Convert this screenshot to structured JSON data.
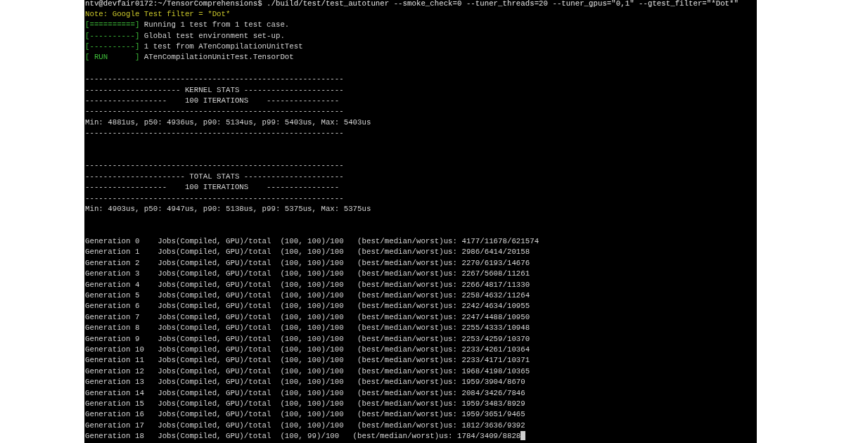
{
  "terminal": {
    "cursor": true,
    "lines": [
      {
        "kind": "prompt",
        "text": "ntv@devfair0172:~/TensorComprehensions$ ./build/test/test_autotuner --smoke_check=0 --tuner_threads=20 --tuner_gpus=\"0,1\" --gtest_filter=\"*Dot*\""
      },
      {
        "kind": "note",
        "text": "Note: Google Test filter = *Dot*"
      },
      {
        "kind": "gtest",
        "tag": "[==========]",
        "text": "Running 1 test from 1 test case."
      },
      {
        "kind": "gtest",
        "tag": "[----------]",
        "text": "Global test environment set-up."
      },
      {
        "kind": "gtest",
        "tag": "[----------]",
        "text": "1 test from ATenCompilationUnitTest"
      },
      {
        "kind": "gtest",
        "tag": "[ RUN      ]",
        "text": "ATenCompilationUnitTest.TensorDot"
      },
      {
        "kind": "blank"
      },
      {
        "kind": "rule",
        "text": "---------------------------------------------------------"
      },
      {
        "kind": "heading",
        "text": "--------------------- KERNEL STATS ----------------------"
      },
      {
        "kind": "heading",
        "text": "------------------    100 ITERATIONS    ----------------"
      },
      {
        "kind": "rule",
        "text": "---------------------------------------------------------"
      },
      {
        "kind": "stats",
        "text": "Min: 4881us, p50: 4936us, p90: 5134us, p99: 5403us, Max: 5403us"
      },
      {
        "kind": "rule",
        "text": "---------------------------------------------------------"
      },
      {
        "kind": "blank"
      },
      {
        "kind": "blank"
      },
      {
        "kind": "rule",
        "text": "---------------------------------------------------------"
      },
      {
        "kind": "heading",
        "text": "---------------------- TOTAL STATS ----------------------"
      },
      {
        "kind": "heading",
        "text": "------------------    100 ITERATIONS    ----------------"
      },
      {
        "kind": "rule",
        "text": "---------------------------------------------------------"
      },
      {
        "kind": "stats",
        "text": "Min: 4903us, p50: 4947us, p90: 5138us, p99: 5375us, Max: 5375us"
      },
      {
        "kind": "blank"
      },
      {
        "kind": "blank"
      },
      {
        "kind": "generation",
        "generation": "Generation 0",
        "jobs": "Jobs(Compiled, GPU)/total",
        "counts": "(100, 100)/100",
        "timings": "(best/median/worst)us: 4177/11678/621574"
      },
      {
        "kind": "generation",
        "generation": "Generation 1",
        "jobs": "Jobs(Compiled, GPU)/total",
        "counts": "(100, 100)/100",
        "timings": "(best/median/worst)us: 2986/6414/20158"
      },
      {
        "kind": "generation",
        "generation": "Generation 2",
        "jobs": "Jobs(Compiled, GPU)/total",
        "counts": "(100, 100)/100",
        "timings": "(best/median/worst)us: 2270/6193/14676"
      },
      {
        "kind": "generation",
        "generation": "Generation 3",
        "jobs": "Jobs(Compiled, GPU)/total",
        "counts": "(100, 100)/100",
        "timings": "(best/median/worst)us: 2267/5608/11261"
      },
      {
        "kind": "generation",
        "generation": "Generation 4",
        "jobs": "Jobs(Compiled, GPU)/total",
        "counts": "(100, 100)/100",
        "timings": "(best/median/worst)us: 2266/4817/11330"
      },
      {
        "kind": "generation",
        "generation": "Generation 5",
        "jobs": "Jobs(Compiled, GPU)/total",
        "counts": "(100, 100)/100",
        "timings": "(best/median/worst)us: 2258/4632/11264"
      },
      {
        "kind": "generation",
        "generation": "Generation 6",
        "jobs": "Jobs(Compiled, GPU)/total",
        "counts": "(100, 100)/100",
        "timings": "(best/median/worst)us: 2242/4634/10955"
      },
      {
        "kind": "generation",
        "generation": "Generation 7",
        "jobs": "Jobs(Compiled, GPU)/total",
        "counts": "(100, 100)/100",
        "timings": "(best/median/worst)us: 2247/4488/10950"
      },
      {
        "kind": "generation",
        "generation": "Generation 8",
        "jobs": "Jobs(Compiled, GPU)/total",
        "counts": "(100, 100)/100",
        "timings": "(best/median/worst)us: 2255/4333/10948"
      },
      {
        "kind": "generation",
        "generation": "Generation 9",
        "jobs": "Jobs(Compiled, GPU)/total",
        "counts": "(100, 100)/100",
        "timings": "(best/median/worst)us: 2253/4259/10370"
      },
      {
        "kind": "generation",
        "generation": "Generation 10",
        "jobs": "Jobs(Compiled, GPU)/total",
        "counts": "(100, 100)/100",
        "timings": "(best/median/worst)us: 2233/4261/10364"
      },
      {
        "kind": "generation",
        "generation": "Generation 11",
        "jobs": "Jobs(Compiled, GPU)/total",
        "counts": "(100, 100)/100",
        "timings": "(best/median/worst)us: 2233/4171/10371"
      },
      {
        "kind": "generation",
        "generation": "Generation 12",
        "jobs": "Jobs(Compiled, GPU)/total",
        "counts": "(100, 100)/100",
        "timings": "(best/median/worst)us: 1968/4198/10365"
      },
      {
        "kind": "generation",
        "generation": "Generation 13",
        "jobs": "Jobs(Compiled, GPU)/total",
        "counts": "(100, 100)/100",
        "timings": "(best/median/worst)us: 1959/3904/8670"
      },
      {
        "kind": "generation",
        "generation": "Generation 14",
        "jobs": "Jobs(Compiled, GPU)/total",
        "counts": "(100, 100)/100",
        "timings": "(best/median/worst)us: 2084/3426/7846"
      },
      {
        "kind": "generation",
        "generation": "Generation 15",
        "jobs": "Jobs(Compiled, GPU)/total",
        "counts": "(100, 100)/100",
        "timings": "(best/median/worst)us: 1959/3483/8929"
      },
      {
        "kind": "generation",
        "generation": "Generation 16",
        "jobs": "Jobs(Compiled, GPU)/total",
        "counts": "(100, 100)/100",
        "timings": "(best/median/worst)us: 1959/3651/9465"
      },
      {
        "kind": "generation",
        "generation": "Generation 17",
        "jobs": "Jobs(Compiled, GPU)/total",
        "counts": "(100, 100)/100",
        "timings": "(best/median/worst)us: 1812/3636/9392"
      },
      {
        "kind": "generation",
        "generation": "Generation 18",
        "jobs": "Jobs(Compiled, GPU)/total",
        "counts": "(100, 99)/100",
        "timings": "(best/median/worst)us: 1784/3409/8828"
      }
    ]
  }
}
